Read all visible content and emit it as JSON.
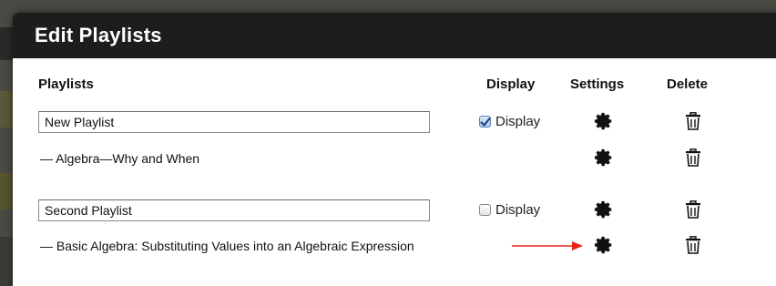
{
  "modal": {
    "title": "Edit Playlists"
  },
  "columns": {
    "playlists": "Playlists",
    "display": "Display",
    "settings": "Settings",
    "delete": "Delete"
  },
  "playlists": [
    {
      "name": "New Playlist",
      "display_label": "Display",
      "display_checked": true,
      "items": [
        "— Algebra—Why and When"
      ]
    },
    {
      "name": "Second Playlist",
      "display_label": "Display",
      "display_checked": false,
      "items": [
        "— Basic Algebra: Substituting Values into an Algebraic Expression"
      ]
    }
  ],
  "icons": {
    "settings": "gear-icon",
    "delete": "trash-icon",
    "annotation": "red-arrow-icon"
  },
  "colors": {
    "header_bg": "#1e1d1d",
    "header_text": "#ffffff",
    "arrow": "#e8231b"
  }
}
